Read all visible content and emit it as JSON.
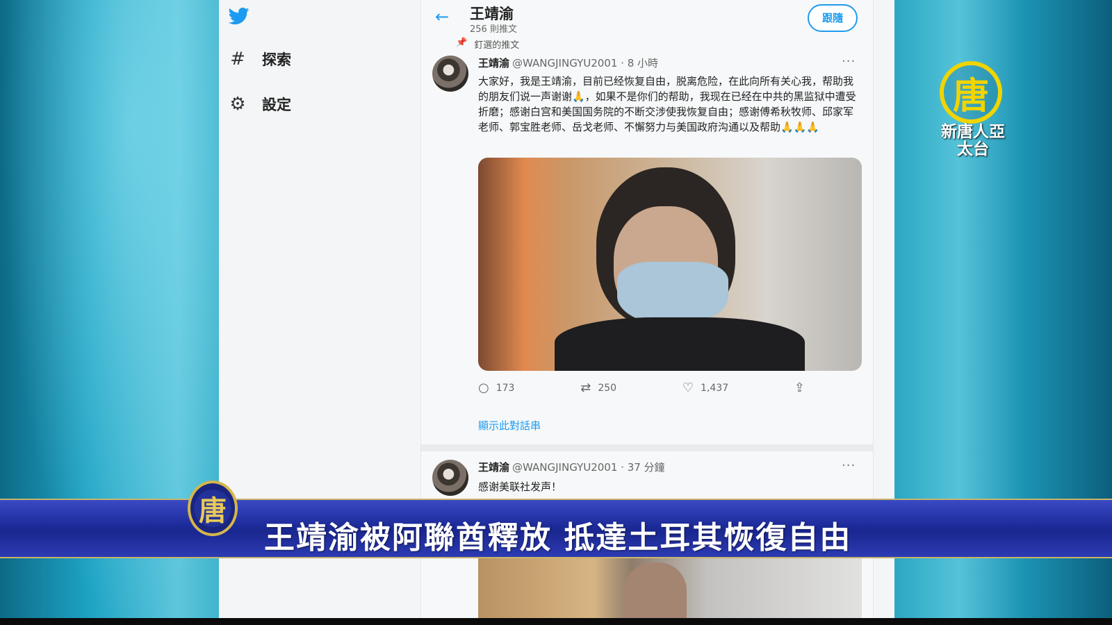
{
  "sidebar": {
    "items": [
      {
        "icon": "hashtag-icon",
        "glyph": "#",
        "label": "探索"
      },
      {
        "icon": "gear-icon",
        "glyph": "⚙",
        "label": "設定"
      }
    ]
  },
  "header": {
    "name": "王靖渝",
    "tweet_count": "256 則推文",
    "follow_label": "跟隨"
  },
  "pinned_label": "釘選的推文",
  "tweet1": {
    "name": "王靖渝",
    "handle": "@WANGJINGYU2001 · 8 小時",
    "text": "大家好，我是王靖渝，目前已经恢复自由，脱离危险，在此向所有关心我，帮助我的朋友们说一声谢谢🙏，如果不是你们的帮助，我现在已经在中共的黑监狱中遭受折磨；感谢白宫和美国国务院的不断交涉使我恢复自由；感谢傅希秋牧师、邱家军老师、郭宝胜老师、岳戈老师、不懈努力与美国政府沟通以及帮助🙏🙏🙏",
    "replies": "173",
    "retweets": "250",
    "likes": "1,437",
    "thread_link": "顯示此對話串"
  },
  "tweet2": {
    "name": "王靖渝",
    "handle": "@WANGJINGYU2001 · 37 分鐘",
    "text": "感谢美联社发声！"
  },
  "broadcast": {
    "headline": "王靖渝被阿聯酋釋放 抵達土耳其恢復自由",
    "channel_logo_char": "唐",
    "channel_name": "新唐人亞太台"
  },
  "colors": {
    "twitter_blue": "#1d9bf0",
    "banner_blue": "#1d2b9a",
    "logo_gold": "#f1d400"
  }
}
